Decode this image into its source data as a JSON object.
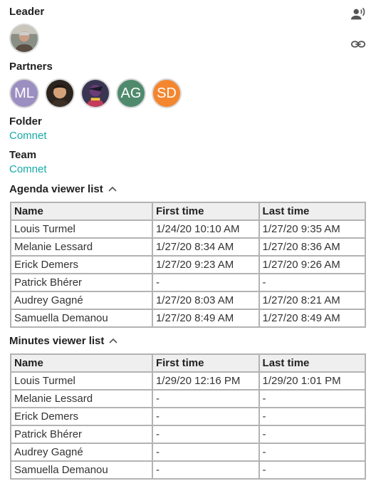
{
  "leader": {
    "label": "Leader"
  },
  "partners": {
    "label": "Partners",
    "items": [
      {
        "type": "initials",
        "text": "ML",
        "color": "#9b8fc1"
      },
      {
        "type": "photo",
        "name": "partner-photo-1"
      },
      {
        "type": "photo",
        "name": "partner-photo-2"
      },
      {
        "type": "initials",
        "text": "AG",
        "color": "#4f8a6d"
      },
      {
        "type": "initials",
        "text": "SD",
        "color": "#f4862f"
      }
    ]
  },
  "folder": {
    "label": "Folder",
    "value": "Comnet"
  },
  "team": {
    "label": "Team",
    "value": "Comnet"
  },
  "agenda": {
    "title": "Agenda viewer list",
    "headers": [
      "Name",
      "First time",
      "Last time"
    ],
    "rows": [
      [
        "Louis Turmel",
        "1/24/20 10:10 AM",
        "1/27/20 9:35 AM"
      ],
      [
        "Melanie Lessard",
        "1/27/20 8:34 AM",
        "1/27/20 8:36 AM"
      ],
      [
        "Erick Demers",
        "1/27/20 9:23 AM",
        "1/27/20 9:26 AM"
      ],
      [
        "Patrick Bhérer",
        "-",
        "-"
      ],
      [
        "Audrey Gagné",
        "1/27/20 8:03 AM",
        "1/27/20 8:21 AM"
      ],
      [
        "Samuella Demanou",
        "1/27/20 8:49 AM",
        "1/27/20 8:49 AM"
      ]
    ]
  },
  "minutes": {
    "title": "Minutes viewer list",
    "headers": [
      "Name",
      "First time",
      "Last time"
    ],
    "rows": [
      [
        "Louis Turmel",
        "1/29/20 12:16 PM",
        "1/29/20 1:01 PM"
      ],
      [
        "Melanie Lessard",
        "-",
        "-"
      ],
      [
        "Erick Demers",
        "-",
        "-"
      ],
      [
        "Patrick Bhérer",
        "-",
        "-"
      ],
      [
        "Audrey Gagné",
        "-",
        "-"
      ],
      [
        "Samuella Demanou",
        "-",
        "-"
      ]
    ]
  },
  "icons": {
    "top_right": "person-voice-icon",
    "link": "link-icon",
    "collapse": "chevron-up-icon"
  }
}
